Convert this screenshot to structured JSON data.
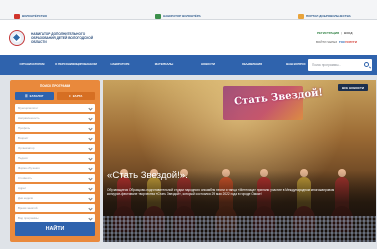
{
  "topbar": {
    "items": [
      {
        "label": "ВОЛОНТЁРСТВО",
        "color": "#d0342c"
      },
      {
        "label": "НАВИГАТОР ВОЛОНТЁРА",
        "color": "#3b8f4b"
      },
      {
        "label": "ПОРТАЛ ДОБРОВОЛЬЧЕСТВА",
        "color": "#e8a33b"
      }
    ]
  },
  "header": {
    "org_name": "НАВИГАТОР ДОПОЛНИТЕЛЬНОГО ОБРАЗОВАНИЯ ДЕТЕЙ ВОЛОГОДСКОЙ ОБЛАСТИ",
    "registration": "РЕГИСТРАЦИЯ",
    "login": "ВХОД",
    "login_via": "ВОЙТИ ЧЕРЕЗ",
    "gosuslugi_blue": "ГОС",
    "gosuslugi_red": "УСЛУГИ"
  },
  "nav": {
    "items": [
      "ОРГАНИЗАТОРАМ",
      "О ПЕРСОНИФИЦИРОВАННОМ",
      "НАВИГАТОРЕ",
      "МАТЕРИАЛЫ",
      "НОВОСТИ",
      "ОБЪЯВЛЕНИЯ",
      "ВАШ ВОПРОС"
    ],
    "search_placeholder": "Поиск программы..."
  },
  "search_panel": {
    "title": "ПОИСК ПРОГРАММ",
    "tab_catalog": "КАТАЛОГ",
    "tab_map": "КАРТА",
    "fields": [
      "Муниципалитет",
      "Направленность",
      "Профиль",
      "Возраст",
      "Организатор",
      "Педагог",
      "Форма обучения",
      "Стоимость",
      "Адрес",
      "Дни недели",
      "Время занятий",
      "Вид программы"
    ],
    "button": "НАЙТИ"
  },
  "banner": {
    "badge": "ВСЕ НОВОСТИ",
    "show_title": "Стать Звездой!",
    "caption_title": "«Стать Звездой!».",
    "caption_text": "Обучающиеся Образцово-подготовительной студии народного ансамбля песни и танца «Метелица» приняли участие в Международном многожанровом конкурсе-фестивале творчества «Стать Звездой», который состоялся 29 мая 2022 года в городе Омске!",
    "colors": {
      "accent": "#2f63ad",
      "panel": "#e9893c"
    }
  }
}
